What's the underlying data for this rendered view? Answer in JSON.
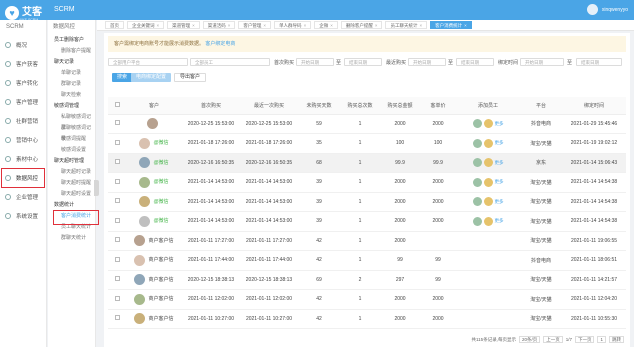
{
  "app": {
    "name": "艾客",
    "subtitle": "AIKE SCRM",
    "scrm": "SCRM",
    "user": "xinqwenyyo"
  },
  "nav1": {
    "title": "SCRM",
    "items": [
      {
        "label": "概况",
        "icon": "home-icon"
      },
      {
        "label": "客户获客",
        "icon": "customer-acquire-icon"
      },
      {
        "label": "客户转化",
        "icon": "conversion-icon"
      },
      {
        "label": "客户管理",
        "icon": "customer-manage-icon"
      },
      {
        "label": "社群营销",
        "icon": "community-icon"
      },
      {
        "label": "营销中心",
        "icon": "marketing-icon"
      },
      {
        "label": "素材中心",
        "icon": "material-icon"
      },
      {
        "label": "数据风控",
        "icon": "data-risk-icon",
        "active": true
      },
      {
        "label": "企业管理",
        "icon": "enterprise-icon"
      },
      {
        "label": "系统设置",
        "icon": "settings-icon"
      }
    ]
  },
  "nav2": {
    "title": "数据风控",
    "groups": [
      {
        "label": "员工删除客户",
        "subs": [
          "删除客户提醒"
        ]
      },
      {
        "label": "聊天记录",
        "subs": [
          "单聊记录",
          "群聊记录",
          "聊天检索"
        ]
      },
      {
        "label": "敏感词管理",
        "subs": [
          "私聊敏感词记录",
          "群聊敏感词记录",
          "敏感词提醒",
          "敏感词设置"
        ]
      },
      {
        "label": "聊天超时管理",
        "subs": [
          "聊天超时记录",
          "聊天超时提醒",
          "聊天超时设置"
        ]
      },
      {
        "label": "数据统计",
        "subs": [
          "客户消费统计",
          "员工聊天统计",
          "群聊天统计"
        ]
      }
    ],
    "active_sub": "客户消费统计"
  },
  "tabs": [
    {
      "label": "首页"
    },
    {
      "label": "企业关键词"
    },
    {
      "label": "渠道管理"
    },
    {
      "label": "渠道活码"
    },
    {
      "label": "客户管理"
    },
    {
      "label": "单人群导码"
    },
    {
      "label": "企微"
    },
    {
      "label": "删除客户提醒"
    },
    {
      "label": "员工聊天统计"
    },
    {
      "label": "客户消费统计",
      "active": true
    }
  ],
  "notice": {
    "text": "客户需绑定电商账号才能展示消费数据。",
    "link": "客户绑定电商"
  },
  "filters": {
    "platform": {
      "label": "",
      "placeholder": "全部用户平台"
    },
    "staff": {
      "label": "",
      "placeholder": "全部员工"
    },
    "first_buy": {
      "label": "首次购买",
      "placeholder": "开始日期"
    },
    "first_buy_end": {
      "label": "至",
      "placeholder": "结束日期"
    },
    "last_buy": {
      "label": "最近购买",
      "placeholder": "开始日期"
    },
    "last_buy_end": {
      "label": "至",
      "placeholder": "结束日期"
    },
    "bind_time": {
      "label": "绑定时间",
      "placeholder": "开始日期"
    },
    "bind_time_end": {
      "label": "至",
      "placeholder": "结束日期"
    },
    "search": "搜索",
    "bind": "电商绑定配置",
    "export": "导出客户"
  },
  "table": {
    "headers": [
      "",
      "客户",
      "首次购买",
      "最近一次购买",
      "未购买天数",
      "购买总次数",
      "购买总金额",
      "客单价",
      "添加员工",
      "平台",
      "绑定时间"
    ],
    "rows": [
      {
        "name": "",
        "first": "2020-12-25 15:53:00",
        "last": "2020-12-25 15:53:00",
        "days": "59",
        "times": "1",
        "amount": "2000",
        "avg": "2000",
        "more": "更多",
        "platform": "抖音电商",
        "bind": "2021-01-29 15:45:46",
        "wx": ""
      },
      {
        "name": "@微信",
        "first": "2021-01-18 17:26:00",
        "last": "2021-01-18 17:26:00",
        "days": "35",
        "times": "1",
        "amount": "100",
        "avg": "100",
        "more": "更多",
        "platform": "淘宝/天猫",
        "bind": "2021-01-19 19:02:12",
        "wx": "@微信"
      },
      {
        "name": "@微信",
        "first": "2020-12-16 16:50:35",
        "last": "2020-12-16 16:50:35",
        "days": "68",
        "times": "1",
        "amount": "99.9",
        "avg": "99.9",
        "more": "更多",
        "platform": "京东",
        "bind": "2021-01-14 15:06:43",
        "wx": "@微信"
      },
      {
        "name": "@微信",
        "first": "2021-01-14 14:53:00",
        "last": "2021-01-14 14:53:00",
        "days": "39",
        "times": "1",
        "amount": "2000",
        "avg": "2000",
        "more": "更多",
        "platform": "淘宝/天猫",
        "bind": "2021-01-14 14:54:38",
        "wx": "@微信"
      },
      {
        "name": "@微信",
        "first": "2021-01-14 14:53:00",
        "last": "2021-01-14 14:53:00",
        "days": "39",
        "times": "1",
        "amount": "2000",
        "avg": "2000",
        "more": "更多",
        "platform": "淘宝/天猫",
        "bind": "2021-01-14 14:54:38",
        "wx": "@微信"
      },
      {
        "name": "@微信",
        "first": "2021-01-14 14:53:00",
        "last": "2021-01-14 14:53:00",
        "days": "39",
        "times": "1",
        "amount": "2000",
        "avg": "2000",
        "more": "更多",
        "platform": "淘宝/天猫",
        "bind": "2021-01-14 14:54:38",
        "wx": "@微信"
      },
      {
        "name": "商户客户信",
        "first": "2021-01-11 17:27:00",
        "last": "2021-01-11 17:27:00",
        "days": "42",
        "times": "1",
        "amount": "2000",
        "avg": "",
        "more": "",
        "platform": "淘宝/天猫",
        "bind": "2021-01-11 19:06:55",
        "wx": ""
      },
      {
        "name": "商户客户信",
        "first": "2021-01-11 17:44:00",
        "last": "2021-01-11 17:44:00",
        "days": "42",
        "times": "1",
        "amount": "99",
        "avg": "99",
        "more": "",
        "platform": "抖音电商",
        "bind": "2021-01-11 18:06:51",
        "wx": ""
      },
      {
        "name": "商户客户信",
        "first": "2020-12-15 18:38:13",
        "last": "2020-12-15 18:38:13",
        "days": "69",
        "times": "2",
        "amount": "297",
        "avg": "99",
        "more": "",
        "platform": "淘宝/天猫",
        "bind": "2021-01-11 14:21:57",
        "wx": ""
      },
      {
        "name": "商户客户信",
        "first": "2021-01-11 12:02:00",
        "last": "2021-01-11 12:02:00",
        "days": "42",
        "times": "1",
        "amount": "2000",
        "avg": "2000",
        "more": "",
        "platform": "淘宝/天猫",
        "bind": "2021-01-11 12:04:20",
        "wx": ""
      },
      {
        "name": "商户客户信",
        "first": "2021-01-11 10:27:00",
        "last": "2021-01-11 10:27:00",
        "days": "42",
        "times": "1",
        "amount": "2000",
        "avg": "2000",
        "more": "",
        "platform": "淘宝/天猫",
        "bind": "2021-01-11 10:55:30",
        "wx": ""
      }
    ]
  },
  "pager": {
    "summary": "共115条记录,每页显示",
    "size": "20条/页",
    "prev": "上一页",
    "page": "1/7",
    "next": "下一页",
    "last": "跳转",
    "goto": "1"
  }
}
